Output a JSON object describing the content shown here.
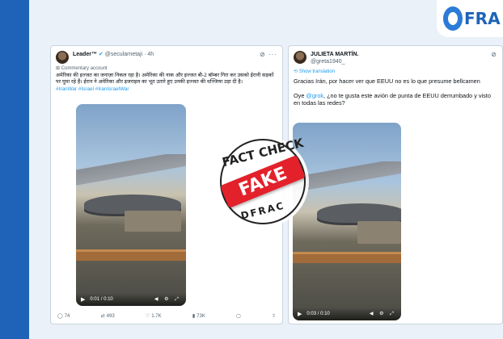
{
  "logo": {
    "text": "FRA"
  },
  "tweet_left": {
    "name": "Leader™",
    "handle": "@secularnetaji · 4h",
    "sub": "Commentary account",
    "text": "अमेरिका की इज्जत का जनाज़ा निकल रहा है। अमेरिका की नाक और इज्जत बी-2 बॉम्बर गिरा कर उसको ईरानी सड़कों पर घुमा रहे हैं। ईरान ने अमेरिका और इजराइल का भूत उतारे हुए उनकी इज्जत की धज्जिया उड़ा दी है।",
    "tags": "#IranWar #Israel #IranIsraelWar",
    "video_time": "0:01 / 0:10",
    "replies": "74",
    "reposts": "493",
    "likes": "1.7K",
    "views": "73K"
  },
  "tweet_right": {
    "name": "JULIETA MARTÍN.",
    "handle": "@greta1940_",
    "sub": "Show translation",
    "text1": "Gracias Irán, por hacer ver que EEUU no es lo que presume bellcamen",
    "text2_prefix": "Oye ",
    "text2_mention": "@grok",
    "text2_suffix": ", ¿no te gusta este avión de punta de EEUU derrumbado y visto en todas las redes?",
    "video_time": "0:03 / 0:10"
  },
  "stamp": {
    "top": "FACT CHECK",
    "label": "FAKE",
    "bottom": "DFRAC"
  },
  "colors": {
    "fake_red": "#e3212b",
    "brand_blue": "#1e63b8",
    "link_blue": "#1d9bf0"
  }
}
